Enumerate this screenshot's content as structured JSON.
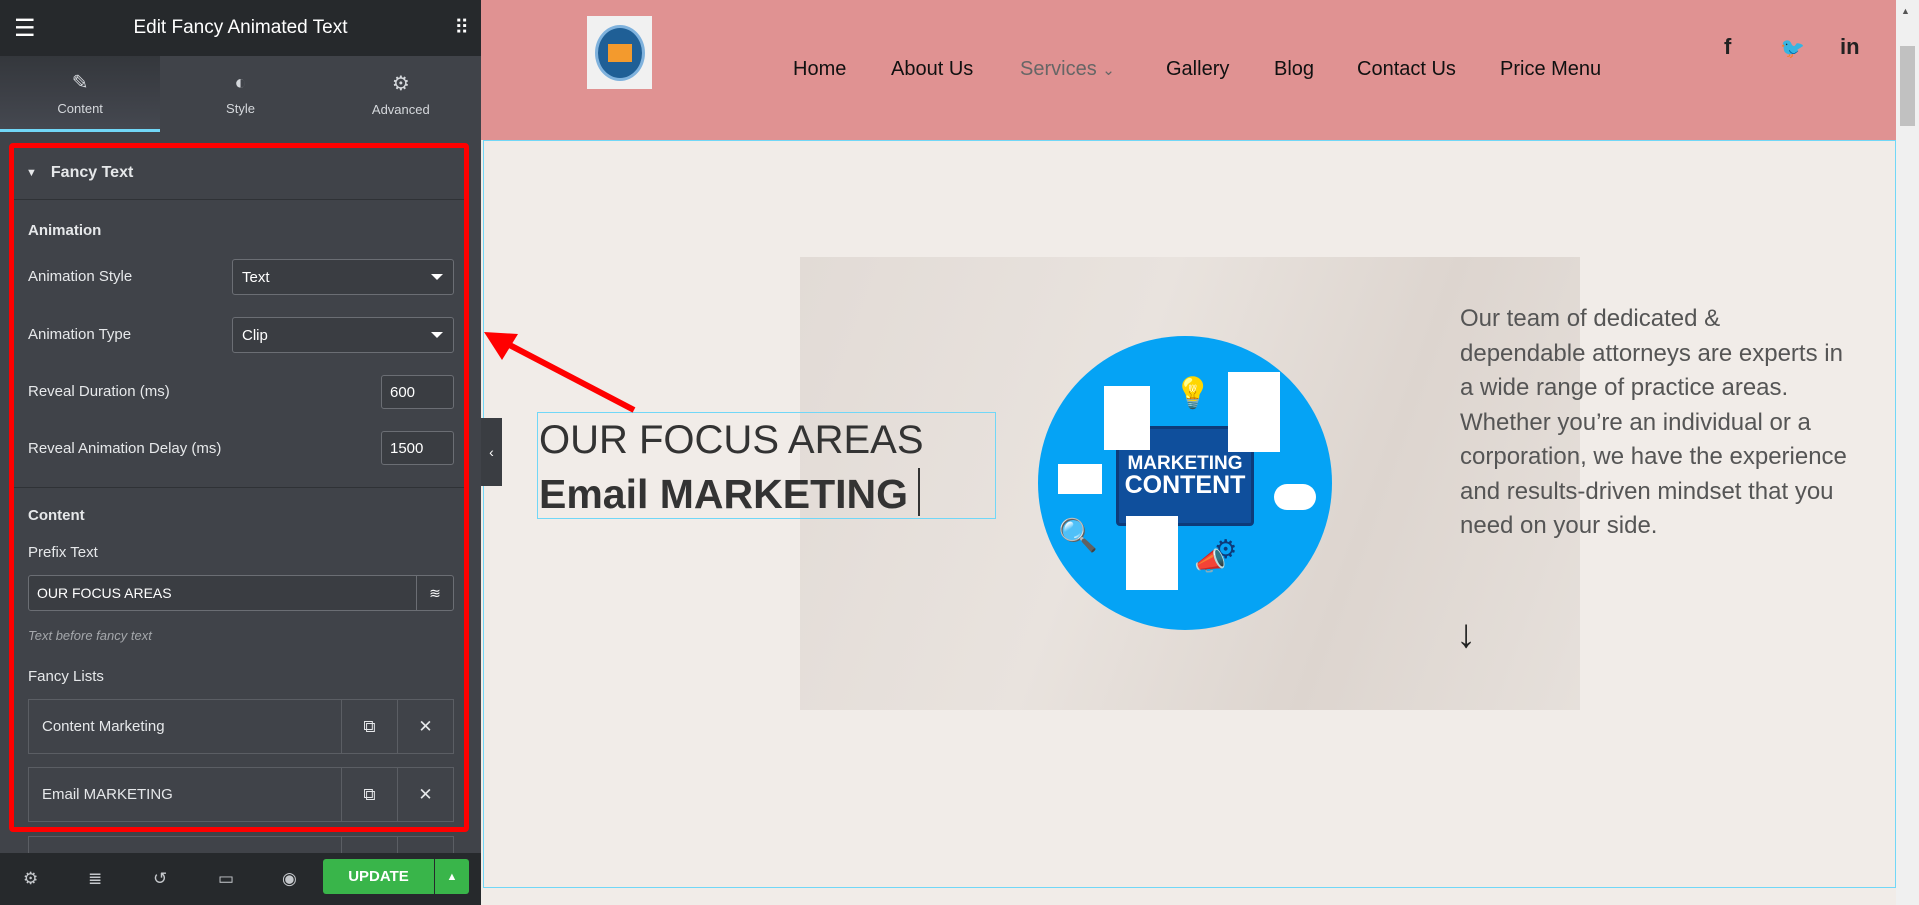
{
  "panel": {
    "title": "Edit Fancy Animated Text",
    "tabs": [
      {
        "label": "Content",
        "icon": "pencil-icon",
        "active": true
      },
      {
        "label": "Style",
        "icon": "half-circle-icon"
      },
      {
        "label": "Advanced",
        "icon": "gear-icon"
      }
    ],
    "section": "Fancy Text",
    "animation": {
      "heading": "Animation",
      "style_label": "Animation Style",
      "style_value": "Text",
      "type_label": "Animation Type",
      "type_value": "Clip",
      "duration_label": "Reveal Duration (ms)",
      "duration_value": "600",
      "delay_label": "Reveal Animation Delay (ms)",
      "delay_value": "1500"
    },
    "content": {
      "heading": "Content",
      "prefix_label": "Prefix Text",
      "prefix_value": "OUR FOCUS AREAS",
      "prefix_hint": "Text before fancy text",
      "lists_label": "Fancy Lists",
      "items": [
        "Content Marketing",
        "Email MARKETING"
      ]
    },
    "footer": {
      "update_label": "UPDATE"
    }
  },
  "site": {
    "nav": [
      "Home",
      "About Us",
      "Services",
      "Gallery",
      "Blog",
      "Contact Us",
      "Price Menu"
    ],
    "heading_prefix": "OUR FOCUS AREAS",
    "heading_fancy": "Email MARKETING",
    "badge_line1": "MARKETING",
    "badge_line2": "CONTENT",
    "paragraph": "Our team of dedicated & dependable attorneys are experts in a wide range of practice areas. Whether you’re an individual or a corporation, we have the experience and results-driven mindset that you need on your side."
  },
  "colors": {
    "accent": "#71d7f7",
    "update": "#39b54a",
    "header": "#e09292",
    "annotation": "#ff0000"
  }
}
